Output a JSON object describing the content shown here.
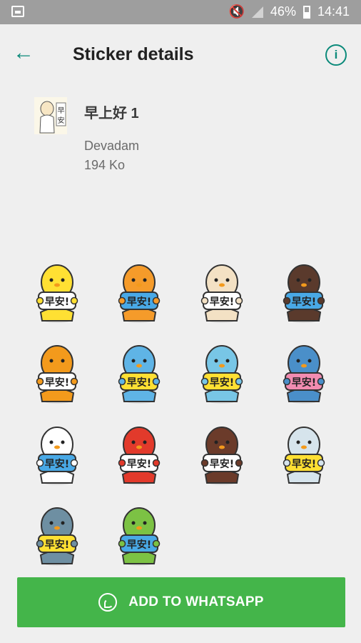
{
  "status_bar": {
    "battery": "46%",
    "time": "14:41",
    "icons": [
      "gallery-icon",
      "mute-icon",
      "signal-icon",
      "battery-icon"
    ]
  },
  "app_bar": {
    "title": "Sticker details",
    "back_icon": "arrow-back-icon",
    "info_icon": "info-icon",
    "accent": "#0b8a7a"
  },
  "pack": {
    "name": "早上好 1",
    "publisher": "Devadam",
    "size": "194 Ko"
  },
  "stickers": [
    {
      "name": "chick",
      "color": "#ffe033",
      "board": "white",
      "text": "早安!"
    },
    {
      "name": "tiger",
      "color": "#f59b2a",
      "board": "blue",
      "text": "早安!"
    },
    {
      "name": "pug",
      "color": "#f3e1c4",
      "board": "white",
      "text": "早安!"
    },
    {
      "name": "panda",
      "color": "#5a3a2c",
      "board": "blue",
      "text": "早安!"
    },
    {
      "name": "bear",
      "color": "#f39a1c",
      "board": "white",
      "text": "早安!"
    },
    {
      "name": "blue-rabbit",
      "color": "#5fb4e6",
      "board": "yellow",
      "text": "早安!"
    },
    {
      "name": "seal",
      "color": "#78c6e6",
      "board": "yellow",
      "text": "早安!"
    },
    {
      "name": "shark",
      "color": "#4a8fc9",
      "board": "pink",
      "text": "早安!"
    },
    {
      "name": "chicken",
      "color": "#ffffff",
      "board": "blue",
      "text": "早安!"
    },
    {
      "name": "octopus",
      "color": "#e23a2b",
      "board": "white",
      "text": "早安!"
    },
    {
      "name": "platypus",
      "color": "#6b3b2a",
      "board": "white",
      "text": "早安!"
    },
    {
      "name": "alien",
      "color": "#d6e4ec",
      "board": "yellow",
      "text": "早安!"
    },
    {
      "name": "owl",
      "color": "#6e8fa2",
      "board": "yellow",
      "text": "早安!"
    },
    {
      "name": "frog",
      "color": "#7cc244",
      "board": "blue",
      "text": "早安!"
    }
  ],
  "board_colors": {
    "white": "#ffffff",
    "blue": "#49a9e6",
    "yellow": "#ffe033",
    "pink": "#f28cb1"
  },
  "add_button": {
    "label": "ADD TO WHATSAPP",
    "icon": "whatsapp-icon",
    "color": "#44b54a"
  }
}
